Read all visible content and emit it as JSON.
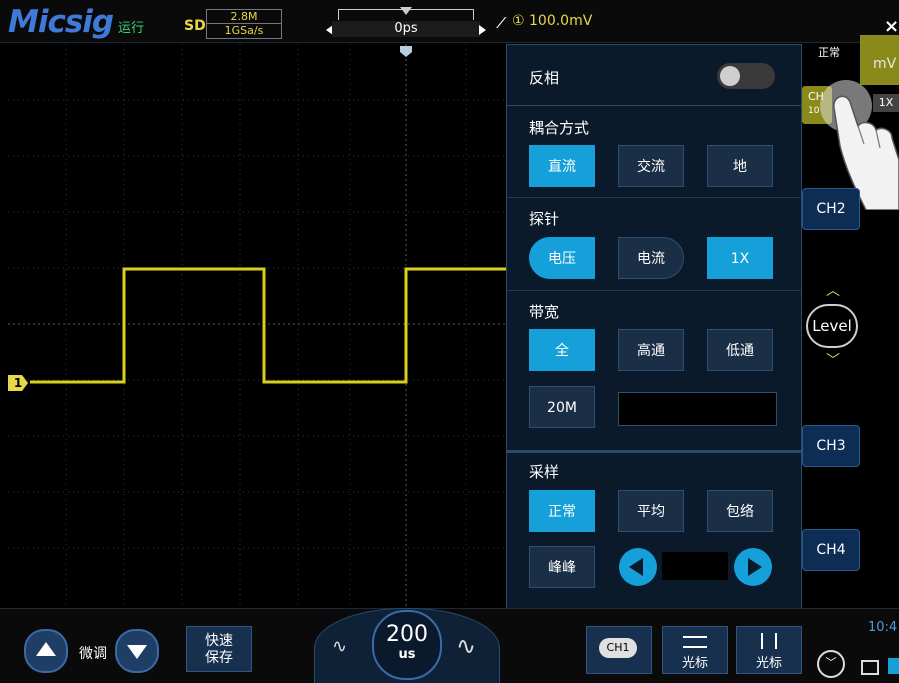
{
  "topbar": {
    "logo": "Micsig",
    "run_state": "运行",
    "sd": "SD",
    "memory_depth": "2.8M",
    "sample_rate": "1GSa/s",
    "time_offset": "0ps",
    "trigger_info": "① 100.0mV",
    "close": "×"
  },
  "waveform": {
    "channel_marker": "1",
    "color": "#d8cf1e"
  },
  "panel": {
    "invert_label": "反相",
    "coupling": {
      "title": "耦合方式",
      "options": [
        "直流",
        "交流",
        "地"
      ],
      "selected": "直流"
    },
    "probe": {
      "title": "探针",
      "options": [
        "电压",
        "电流",
        "1X"
      ],
      "selected": [
        "电压",
        "1X"
      ]
    },
    "bandwidth": {
      "title": "带宽",
      "options": [
        "全",
        "高通",
        "低通"
      ],
      "selected": "全",
      "limit_option": "20M"
    },
    "sampling": {
      "title": "采样",
      "options": [
        "正常",
        "平均",
        "包络"
      ],
      "selected": "正常",
      "peak_label": "峰峰"
    }
  },
  "right": {
    "mode_label": "正常",
    "unit": "mV",
    "ch1_label": "CH",
    "ch1_sub": "10",
    "ch1_probe": "1X",
    "ch2": "CH2",
    "ch3": "CH3",
    "ch4": "CH4",
    "level": "Level",
    "time": "10:4"
  },
  "bottom": {
    "fine_label": "微调",
    "quick_save_line1": "快速",
    "quick_save_line2": "保存",
    "timebase_value": "200",
    "timebase_unit": "us",
    "ch1_tab": "CH1",
    "cursor1_label": "光标",
    "cursor2_label": "光标"
  },
  "colors": {
    "accent": "#15a0d9",
    "trace": "#d8cf1e",
    "panel": "#0b1a2b",
    "logo": "#3f7ad9"
  }
}
